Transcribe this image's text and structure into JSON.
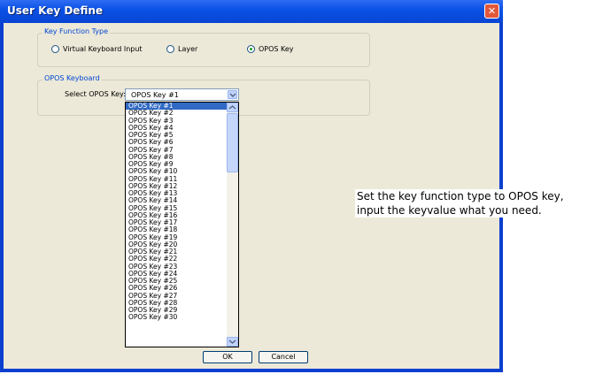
{
  "window": {
    "title": "User Key Define",
    "close_symbol": "✕"
  },
  "key_function_group": {
    "legend": "Key Function Type",
    "options": [
      {
        "label": "Virtual Keyboard Input",
        "checked": false
      },
      {
        "label": "Layer",
        "checked": false
      },
      {
        "label": "OPOS Key",
        "checked": true
      }
    ]
  },
  "opos_group": {
    "legend": "OPOS Keyboard",
    "select_label": "Select OPOS Key:",
    "selected_value": "OPOS Key #1"
  },
  "dropdown_list": {
    "selected_index": 0,
    "items": [
      "OPOS Key #1",
      "OPOS Key #2",
      "OPOS Key #3",
      "OPOS Key #4",
      "OPOS Key #5",
      "OPOS Key #6",
      "OPOS Key #7",
      "OPOS Key #8",
      "OPOS Key #9",
      "OPOS Key #10",
      "OPOS Key #11",
      "OPOS Key #12",
      "OPOS Key #13",
      "OPOS Key #14",
      "OPOS Key #15",
      "OPOS Key #16",
      "OPOS Key #17",
      "OPOS Key #18",
      "OPOS Key #19",
      "OPOS Key #20",
      "OPOS Key #21",
      "OPOS Key #22",
      "OPOS Key #23",
      "OPOS Key #24",
      "OPOS Key #25",
      "OPOS Key #26",
      "OPOS Key #27",
      "OPOS Key #28",
      "OPOS Key #29",
      "OPOS Key #30"
    ]
  },
  "buttons": {
    "ok": "OK",
    "cancel": "Cancel"
  },
  "annotation": {
    "line1": "Set the key function type to OPOS key,",
    "line2": "input the keyvalue what you need."
  },
  "colors": {
    "title_bar": "#0b52e6",
    "dialog_bg": "#ece9d8",
    "group_legend": "#0046d5",
    "selection": "#316ac5"
  }
}
